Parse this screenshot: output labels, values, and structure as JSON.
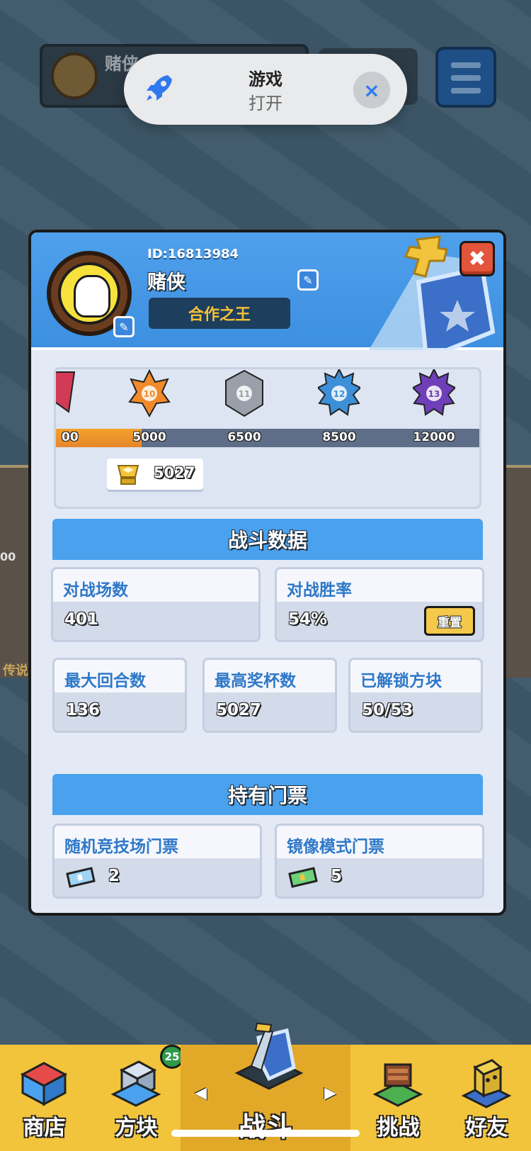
{
  "notification": {
    "app_name": "游戏",
    "action": "打开",
    "close_glyph": "×",
    "accent": "#2f79f0"
  },
  "background": {
    "player_name": "赌侠",
    "left_card_label": "传说",
    "left_card_value": "00"
  },
  "profile": {
    "id_text": "ID:16813984",
    "name": "赌侠",
    "title": "合作之王",
    "edit_glyph": "✎",
    "close_glyph": "✖"
  },
  "rank": {
    "ticks": [
      {
        "label": "00",
        "pos": 0.0
      },
      {
        "label": "5000",
        "pos": 0.0
      },
      {
        "label": "6500",
        "pos": 0.0
      },
      {
        "label": "8500",
        "pos": 0.0
      },
      {
        "label": "12000",
        "pos": 0.0
      }
    ],
    "badges": [
      {
        "level": "",
        "color": "#d23a55",
        "shape": "flag"
      },
      {
        "level": "10",
        "color": "#f08a2a",
        "shape": "star"
      },
      {
        "level": "11",
        "color": "#9aa0aa",
        "shape": "hex"
      },
      {
        "level": "12",
        "color": "#3d8fd8",
        "shape": "spike"
      },
      {
        "level": "13",
        "color": "#6e3fb8",
        "shape": "spike"
      }
    ],
    "progress_fraction": 0.2,
    "trophies": "5027"
  },
  "battle_stats": {
    "header": "战斗数据",
    "matches_label": "对战场数",
    "matches_value": "401",
    "winrate_label": "对战胜率",
    "winrate_value": "54%",
    "reset_label": "重置",
    "max_rounds_label": "最大回合数",
    "max_rounds_value": "136",
    "max_trophies_label": "最高奖杯数",
    "max_trophies_value": "5027",
    "unlocked_label": "已解锁方块",
    "unlocked_value": "50/53"
  },
  "tickets": {
    "header": "持有门票",
    "random_arena_label": "随机竞技场门票",
    "random_arena_value": "2",
    "mirror_mode_label": "镜像模式门票",
    "mirror_mode_value": "5"
  },
  "nav": {
    "shop": "商店",
    "blocks": "方块",
    "blocks_badge": "25",
    "battle": "战斗",
    "challenge": "挑战",
    "friends": "好友",
    "left_arrow": "◀",
    "right_arrow": "▶"
  },
  "colors": {
    "header_blue": "#4aa2ee",
    "label_blue": "#2e78c8",
    "nav_yellow": "#f2c43c",
    "close_red": "#e2543b"
  }
}
